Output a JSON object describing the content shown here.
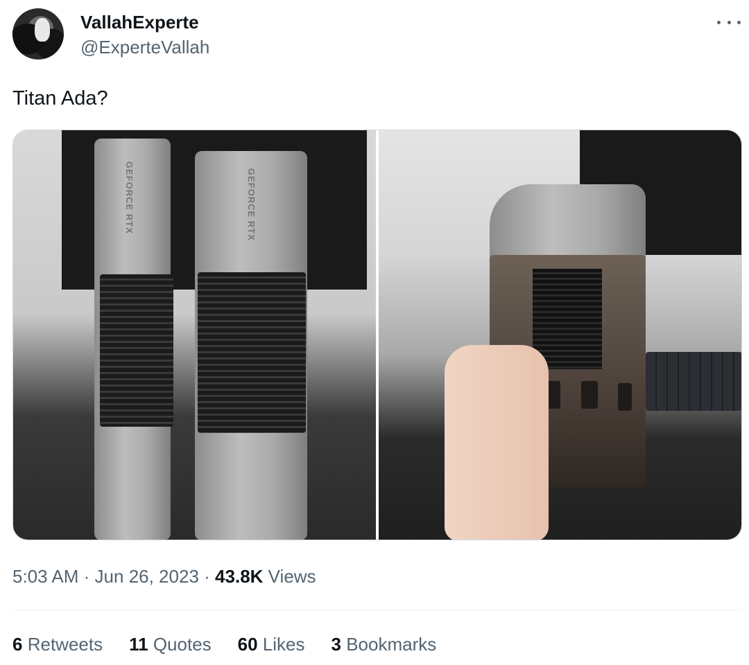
{
  "author": {
    "display_name": "VallahExperte",
    "handle": "@ExperteVallah"
  },
  "tweet": {
    "text": "Titan Ada?"
  },
  "media": {
    "left_labels": [
      "GEFORCE RTX",
      "GEFORCE RTX"
    ]
  },
  "meta": {
    "time": "5:03 AM",
    "sep1": "·",
    "date": "Jun 26, 2023",
    "sep2": "·",
    "views_count": "43.8K",
    "views_label": "Views"
  },
  "stats": {
    "retweets_count": "6",
    "retweets_label": "Retweets",
    "quotes_count": "11",
    "quotes_label": "Quotes",
    "likes_count": "60",
    "likes_label": "Likes",
    "bookmarks_count": "3",
    "bookmarks_label": "Bookmarks"
  },
  "icons": {
    "more": "more-horizontal-icon"
  }
}
